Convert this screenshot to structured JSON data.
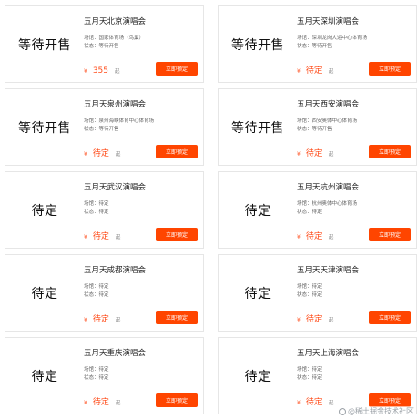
{
  "concerts": [
    {
      "status": "等待开售",
      "title": "五月天北京演唱会",
      "venue": "场馆：国家体育场（鸟巢）",
      "state": "状态：等待开售",
      "currency": "¥",
      "price": "355",
      "unit": "起",
      "button": "立即预定"
    },
    {
      "status": "等待开售",
      "title": "五月天深圳演唱会",
      "venue": "场馆：深圳龙岗大运中心体育场",
      "state": "状态：等待开售",
      "currency": "¥",
      "price": "待定",
      "unit": "起",
      "button": "立即预定"
    },
    {
      "status": "等待开售",
      "title": "五月天泉州演唱会",
      "venue": "场馆：泉州海峡体育中心体育场",
      "state": "状态：等待开售",
      "currency": "¥",
      "price": "待定",
      "unit": "起",
      "button": "立即预定"
    },
    {
      "status": "等待开售",
      "title": "五月天西安演唱会",
      "venue": "场馆：西安奥体中心体育场",
      "state": "状态：等待开售",
      "currency": "¥",
      "price": "待定",
      "unit": "起",
      "button": "立即预定"
    },
    {
      "status": "待定",
      "title": "五月天武汉演唱会",
      "venue": "场馆：待定",
      "state": "状态：待定",
      "currency": "¥",
      "price": "待定",
      "unit": "起",
      "button": "立即预定"
    },
    {
      "status": "待定",
      "title": "五月天杭州演唱会",
      "venue": "场馆：杭州奥体中心体育场",
      "state": "状态：待定",
      "currency": "¥",
      "price": "待定",
      "unit": "起",
      "button": "立即预定"
    },
    {
      "status": "待定",
      "title": "五月天成都演唱会",
      "venue": "场馆：待定",
      "state": "状态：待定",
      "currency": "¥",
      "price": "待定",
      "unit": "起",
      "button": "立即预定"
    },
    {
      "status": "待定",
      "title": "五月天天津演唱会",
      "venue": "场馆：待定",
      "state": "状态：待定",
      "currency": "¥",
      "price": "待定",
      "unit": "起",
      "button": "立即预定"
    },
    {
      "status": "待定",
      "title": "五月天重庆演唱会",
      "venue": "场馆：待定",
      "state": "状态：待定",
      "currency": "¥",
      "price": "待定",
      "unit": "起",
      "button": "立即预定"
    },
    {
      "status": "待定",
      "title": "五月天上海演唱会",
      "venue": "场馆：待定",
      "state": "状态：待定",
      "currency": "¥",
      "price": "待定",
      "unit": "起",
      "button": "立即预定"
    }
  ],
  "watermark": "@稀土掘金技术社区",
  "colors": {
    "accent": "#ff4500",
    "price": "#ff4c1a",
    "border": "#e6e6e6"
  }
}
